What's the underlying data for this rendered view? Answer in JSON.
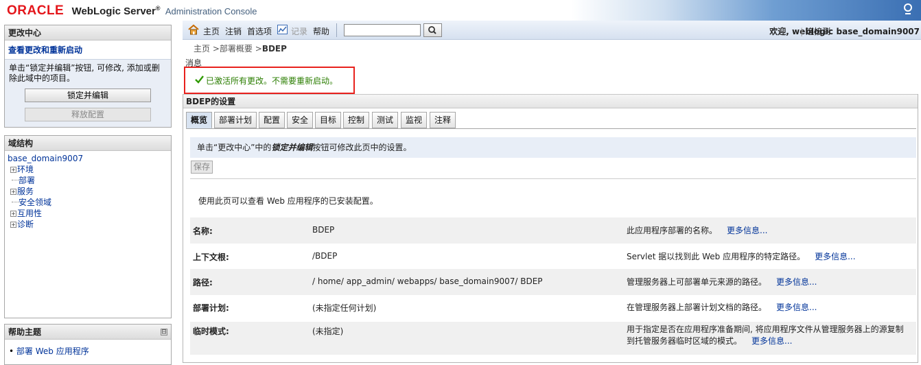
{
  "banner": {
    "brand": "ORACLE",
    "product": "WebLogic Server",
    "reg": "®",
    "console": "Administration Console"
  },
  "change_center": {
    "title": "更改中心",
    "view_link": "查看更改和重新启动",
    "description": "单击“锁定并编辑”按钮, 可修改, 添加或删除此域中的项目。",
    "lock_button": "锁定并编辑",
    "release_button": "释放配置"
  },
  "domain_structure": {
    "title": "域结构",
    "root": "base_domain9007",
    "nodes": [
      {
        "label": "环境",
        "expandable": "true"
      },
      {
        "label": "部署",
        "expandable": "false"
      },
      {
        "label": "服务",
        "expandable": "true"
      },
      {
        "label": "安全领域",
        "expandable": "false"
      },
      {
        "label": "互用性",
        "expandable": "true"
      },
      {
        "label": "诊断",
        "expandable": "true"
      }
    ]
  },
  "help_topics": {
    "title": "帮助主题",
    "collapse": "⊟",
    "items": [
      "部署 Web 应用程序"
    ]
  },
  "toolbar": {
    "home": "主页",
    "logout": "注销",
    "preferences": "首选项",
    "record": "记录",
    "help": "帮助",
    "search_value": "",
    "welcome": "欢迎, weblogic",
    "connected_label": "连接到:",
    "domain": "base_domain9007"
  },
  "breadcrumb": {
    "home": "主页",
    "deployments": "部署概要",
    "current": "BDEP",
    "sep": ">"
  },
  "messages": {
    "label": "消息",
    "success": "已激活所有更改。不需要重新启动。"
  },
  "settings": {
    "title": "BDEP的设置",
    "tabs": [
      "概览",
      "部署计划",
      "配置",
      "安全",
      "目标",
      "控制",
      "测试",
      "监视",
      "注释"
    ],
    "active_tab": "概览",
    "edit_note_pre": "单击“更改中心”中的",
    "edit_note_em": "锁定并编辑",
    "edit_note_post": "按钮可修改此页中的设置。",
    "save_button": "保存",
    "page_description": "使用此页可以查看 Web 应用程序的已安装配置。",
    "more_info": "更多信息...",
    "rows": [
      {
        "label": "名称:",
        "value": "BDEP",
        "help": "此应用程序部署的名称。"
      },
      {
        "label": "上下文根:",
        "value": "/BDEP",
        "help": "Servlet 据以找到此 Web 应用程序的特定路径。"
      },
      {
        "label": "路径:",
        "value": "/ home/ app_admin/ webapps/ base_domain9007/ BDEP",
        "help": "管理服务器上可部署单元来源的路径。"
      },
      {
        "label": "部署计划:",
        "value": "(未指定任何计划)",
        "help": "在管理服务器上部署计划文档的路径。"
      },
      {
        "label": "临时模式:",
        "value": "(未指定)",
        "help_line1": "用于指定是否在应用程序准备期间, 将应用程序文件从管理服务器上的源复制",
        "help_line2": "到托管服务器临时区域的模式。"
      }
    ]
  },
  "colors": {
    "oracle_red": "#e4161b",
    "link_blue": "#003399",
    "success_green": "#2a7d00",
    "highlight_red": "#e8201c"
  }
}
